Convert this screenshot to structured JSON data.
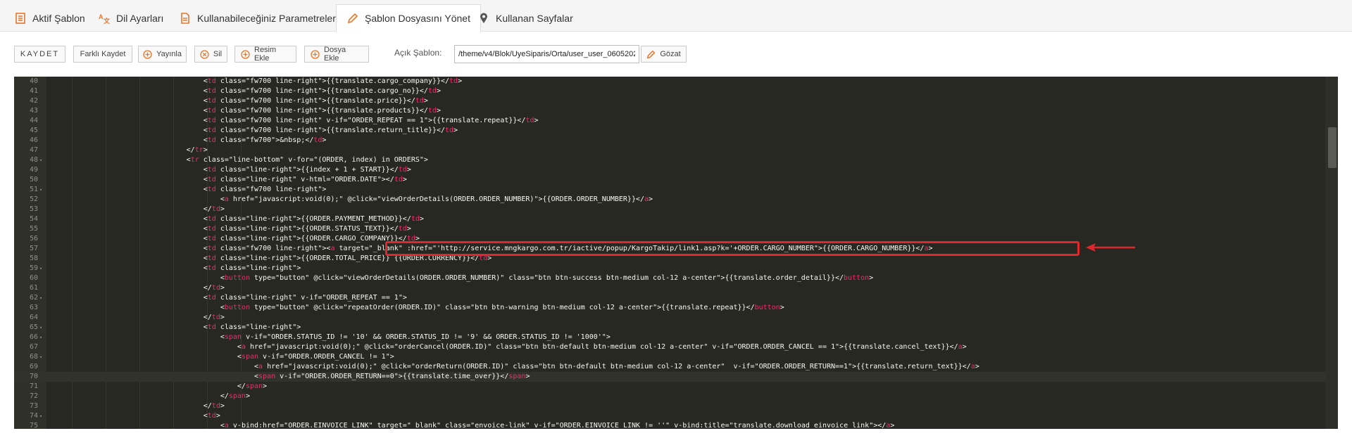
{
  "tabs": [
    {
      "label": "Aktif Şablon",
      "icon": "list-icon",
      "active": false
    },
    {
      "label": "Dil Ayarları",
      "icon": "translate-icon",
      "active": false
    },
    {
      "label": "Kullanabileceğiniz Parametreler",
      "icon": "document-icon",
      "active": false
    },
    {
      "label": "Şablon Dosyasını Yönet",
      "icon": "pencil-icon",
      "active": true
    },
    {
      "label": "Kullanan Sayfalar",
      "icon": "pin-icon",
      "active": false
    }
  ],
  "toolbar": {
    "save_label": "KAYDET",
    "save_as_label": "Farklı Kaydet",
    "publish_label": "Yayınla",
    "delete_label": "Sil",
    "add_image_label": "Resim Ekle",
    "add_file_label": "Dosya Ekle",
    "open_template_label": "Açık Şablon:",
    "open_template_path": "/theme/v4/Blok/UyeSiparis/Orta/user_user_0605202",
    "browse_label": "Gözat"
  },
  "colors": {
    "accent": "#e8762b",
    "editor_bg": "#272822",
    "tag": "#f92672",
    "attribute": "#a6e22e",
    "string": "#e6db74",
    "highlight": "#e0282c"
  },
  "editor": {
    "lines": [
      {
        "n": "40",
        "fold": "",
        "code": "                                    <td class=\"fw700 line-right\">{{translate.cargo_company}}</td>"
      },
      {
        "n": "41",
        "fold": "",
        "code": "                                    <td class=\"fw700 line-right\">{{translate.cargo_no}}</td>"
      },
      {
        "n": "42",
        "fold": "",
        "code": "                                    <td class=\"fw700 line-right\">{{translate.price}}</td>"
      },
      {
        "n": "43",
        "fold": "",
        "code": "                                    <td class=\"fw700 line-right\">{{translate.products}}</td>"
      },
      {
        "n": "44",
        "fold": "",
        "code": "                                    <td class=\"fw700 line-right\" v-if=\"ORDER_REPEAT == 1\">{{translate.repeat}}</td>"
      },
      {
        "n": "45",
        "fold": "",
        "code": "                                    <td class=\"fw700 line-right\">{{translate.return_title}}</td>"
      },
      {
        "n": "46",
        "fold": "",
        "code": "                                    <td class=\"fw700\">&nbsp;</td>"
      },
      {
        "n": "47",
        "fold": "",
        "code": "                                </tr>"
      },
      {
        "n": "48",
        "fold": "▾",
        "code": "                                <tr class=\"line-bottom\" v-for=\"(ORDER, index) in ORDERS\">"
      },
      {
        "n": "49",
        "fold": "",
        "code": "                                    <td class=\"line-right\">{{index + 1 + START}}</td>"
      },
      {
        "n": "50",
        "fold": "",
        "code": "                                    <td class=\"line-right\" v-html=\"ORDER.DATE\"></td>"
      },
      {
        "n": "51",
        "fold": "▾",
        "code": "                                    <td class=\"fw700 line-right\">"
      },
      {
        "n": "52",
        "fold": "",
        "code": "                                        <a href=\"javascript:void(0);\" @click=\"viewOrderDetails(ORDER.ORDER_NUMBER)\">{{ORDER.ORDER_NUMBER}}</a>"
      },
      {
        "n": "53",
        "fold": "",
        "code": "                                    </td>"
      },
      {
        "n": "54",
        "fold": "",
        "code": "                                    <td class=\"line-right\">{{ORDER.PAYMENT_METHOD}}</td>"
      },
      {
        "n": "55",
        "fold": "",
        "code": "                                    <td class=\"line-right\">{{ORDER.STATUS_TEXT}}</td>"
      },
      {
        "n": "56",
        "fold": "",
        "code": "                                    <td class=\"line-right\">{{ORDER.CARGO_COMPANY}}</td>"
      },
      {
        "n": "57",
        "fold": "",
        "code": "                                    <td class=\"fw700 line-right\"><a target=\"_blank\" :href=\"'http://service.mngkargo.com.tr/iactive/popup/KargoTakip/link1.asp?k='+ORDER.CARGO_NUMBER\">{{ORDER.CARGO_NUMBER}}</a>"
      },
      {
        "n": "58",
        "fold": "",
        "code": "                                    <td class=\"line-right\">{{ORDER.TOTAL_PRICE}} {{ORDER.CURRENCY}}</td>"
      },
      {
        "n": "59",
        "fold": "▾",
        "code": "                                    <td class=\"line-right\">"
      },
      {
        "n": "60",
        "fold": "",
        "code": "                                        <button type=\"button\" @click=\"viewOrderDetails(ORDER.ORDER_NUMBER)\" class=\"btn btn-success btn-medium col-12 a-center\">{{translate.order_detail}}</button>"
      },
      {
        "n": "61",
        "fold": "",
        "code": "                                    </td>"
      },
      {
        "n": "62",
        "fold": "▾",
        "code": "                                    <td class=\"line-right\" v-if=\"ORDER_REPEAT == 1\">"
      },
      {
        "n": "63",
        "fold": "",
        "code": "                                        <button type=\"button\" @click=\"repeatOrder(ORDER.ID)\" class=\"btn btn-warning btn-medium col-12 a-center\">{{translate.repeat}}</button>"
      },
      {
        "n": "64",
        "fold": "",
        "code": "                                    </td>"
      },
      {
        "n": "65",
        "fold": "▾",
        "code": "                                    <td class=\"line-right\">"
      },
      {
        "n": "66",
        "fold": "▾",
        "code": "                                        <span v-if=\"ORDER.STATUS_ID != '10' && ORDER.STATUS_ID != '9' && ORDER.STATUS_ID != '1000'\">"
      },
      {
        "n": "67",
        "fold": "",
        "code": "                                            <a href=\"javascript:void(0);\" @click=\"orderCancel(ORDER.ID)\" class=\"btn btn-default btn-medium col-12 a-center\" v-if=\"ORDER.ORDER_CANCEL == 1\">{{translate.cancel_text}}</a>"
      },
      {
        "n": "68",
        "fold": "▾",
        "code": "                                            <span v-if=\"ORDER.ORDER_CANCEL != 1\">"
      },
      {
        "n": "69",
        "fold": "",
        "code": "                                                <a href=\"javascript:void(0);\" @click=\"orderReturn(ORDER.ID)\" class=\"btn btn-default btn-medium col-12 a-center\"  v-if=\"ORDER.ORDER_RETURN==1\">{{translate.return_text}}</a>"
      },
      {
        "n": "70",
        "fold": "",
        "code": "                                                <span v-if=\"ORDER.ORDER_RETURN==0\">{{translate.time_over}}</span>"
      },
      {
        "n": "71",
        "fold": "",
        "code": "                                            </span>"
      },
      {
        "n": "72",
        "fold": "",
        "code": "                                        </span>"
      },
      {
        "n": "73",
        "fold": "",
        "code": "                                    </td>"
      },
      {
        "n": "74",
        "fold": "▾",
        "code": "                                    <td>"
      },
      {
        "n": "75",
        "fold": "",
        "code": "                                        <a v-bind:href=\"ORDER.EINVOICE_LINK\" target=\"_blank\" class=\"envoice-link\" v-if=\"ORDER.EINVOICE_LINK != ''\" v-bind:title=\"translate.download_einvoice_link\"></a>"
      }
    ]
  }
}
